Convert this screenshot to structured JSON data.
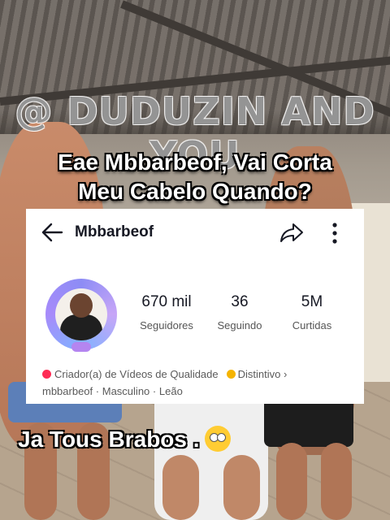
{
  "overlay": {
    "watermark": "@ DUDUZIN AND YOU",
    "caption_line1": "Eae Mbbarbeof, Vai Corta",
    "caption_line2": "Meu Cabelo Quando?",
    "caption_bottom": "Ja Tous Brabos ."
  },
  "profile": {
    "username": "Mbbarbeof",
    "stats": [
      {
        "value": "670 mil",
        "label": "Seguidores"
      },
      {
        "value": "36",
        "label": "Seguindo"
      },
      {
        "value": "5M",
        "label": "Curtidas"
      }
    ],
    "creator_label": "Criador(a) de Vídeos de Qualidade",
    "badge_label": "Distintivo",
    "badge_chevron": "›",
    "meta_handle": "mbbarbeof",
    "meta_gender": "Masculino",
    "meta_sign": "Leão",
    "meta_sep": "·"
  },
  "icons": {
    "back": "arrow-left-icon",
    "share": "share-icon",
    "more": "more-vertical-icon",
    "emoji": "eye-roll-emoji-icon"
  },
  "colors": {
    "accent_red": "#fe2c55",
    "badge_gold": "#f5b400",
    "text_dark": "#161823"
  }
}
